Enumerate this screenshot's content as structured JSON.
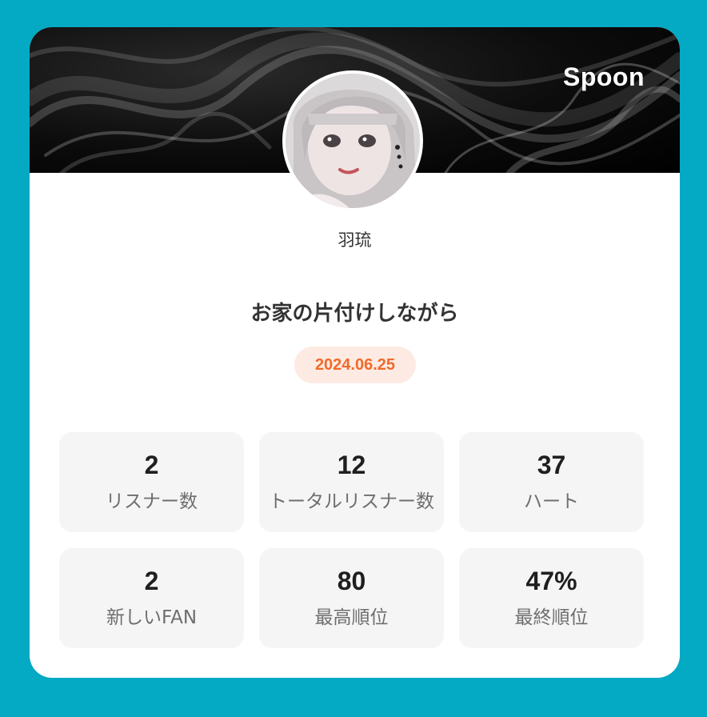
{
  "brand": {
    "name": "Spoon"
  },
  "profile": {
    "username": "羽琉"
  },
  "broadcast": {
    "title": "お家の片付けしながら",
    "date": "2024.06.25"
  },
  "stats": [
    {
      "value": "2",
      "label": "リスナー数"
    },
    {
      "value": "12",
      "label": "トータルリスナー数"
    },
    {
      "value": "37",
      "label": "ハート"
    },
    {
      "value": "2",
      "label": "新しいFAN"
    },
    {
      "value": "80",
      "label": "最高順位"
    },
    {
      "value": "47%",
      "label": "最終順位"
    }
  ],
  "colors": {
    "background": "#04a9c4",
    "card": "#ffffff",
    "date_badge_bg": "#fdebe3",
    "date_badge_text": "#f06a2a",
    "stat_tile": "#f5f5f5"
  }
}
